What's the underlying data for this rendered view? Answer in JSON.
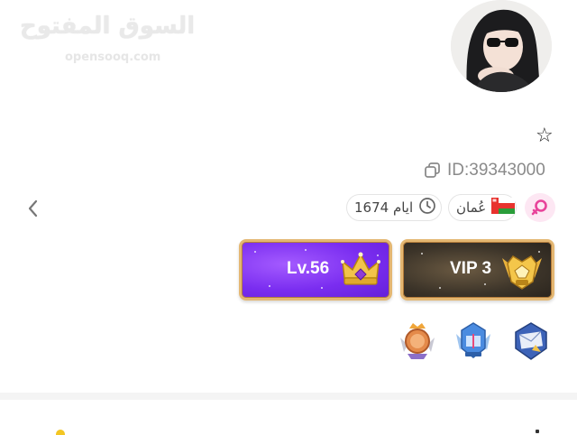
{
  "watermark": {
    "arabic": "السوق المفتوح",
    "latin": "opensooq.com"
  },
  "profile": {
    "user_id": "ID:39343000",
    "country": "عُمان",
    "days": "1674 ايام",
    "level_label": "Lv.56",
    "vip_label": "VIP 3"
  },
  "icons": {
    "star": "star-outline-icon",
    "copy": "copy-icon",
    "back": "chevron-left-icon",
    "flag": "oman-flag-icon",
    "clock": "clock-icon",
    "gender": "female-gender-icon",
    "crown": "crown-icon",
    "vip_emblem": "vip-emblem-icon"
  },
  "colors": {
    "level_badge": "#7a2df0",
    "vip_badge": "#3c3429",
    "badge_border": "#e4b772",
    "gender_pink": "#e8439a"
  }
}
